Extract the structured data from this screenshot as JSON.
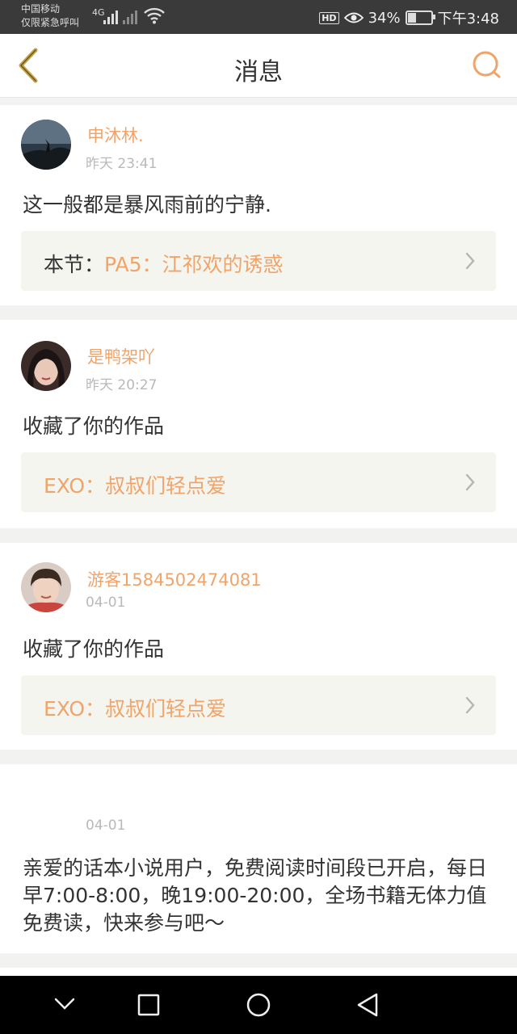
{
  "status_bar": {
    "carrier_line1": "中国移动",
    "carrier_line2": "仅限紧急呼叫",
    "network": "4G",
    "battery_text": "34%",
    "time": "下午3:48",
    "hd_label": "HD",
    "battery_level": 0.34
  },
  "header": {
    "title": "消息",
    "back_icon": "chevron-left-icon",
    "search_icon": "search-icon",
    "accent_color": "#f0a46a"
  },
  "messages": [
    {
      "username": "申沐林.",
      "time": "昨天 23:41",
      "text": "这一般都是暴风雨前的宁静.",
      "link_prefix": "本节：",
      "link_title": "PA5：江祁欢的诱惑"
    },
    {
      "username": "是鸭架吖",
      "time": "昨天 20:27",
      "text": "收藏了你的作品",
      "link_prefix": "",
      "link_title": "EXO：叔叔们轻点爱"
    },
    {
      "username": "游客1584502474081",
      "time": "04-01",
      "text": "收藏了你的作品",
      "link_prefix": "",
      "link_title": "EXO：叔叔们轻点爱"
    },
    {
      "username": "",
      "time": "04-01",
      "text": "亲爱的话本小说用户，免费阅读时间段已开启，每日早7:00-8:00，晚19:00-20:00，全场书籍无体力值免费读，快来参与吧～"
    }
  ],
  "nav_bar": {
    "icons": [
      "chevron-down-icon",
      "square-icon",
      "circle-icon",
      "triangle-back-icon"
    ]
  }
}
